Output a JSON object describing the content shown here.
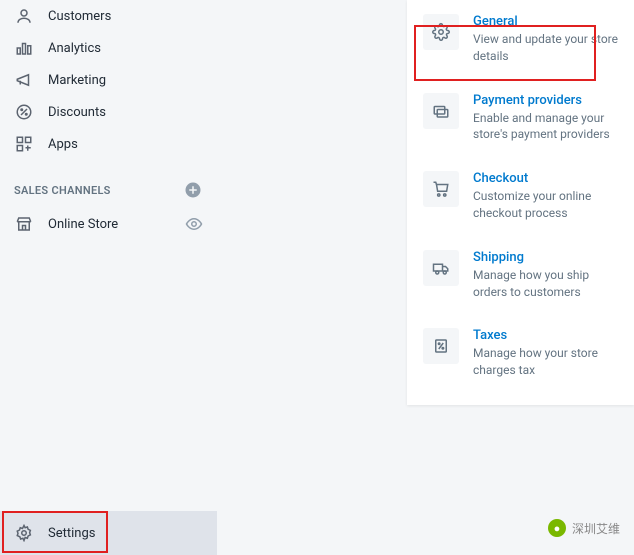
{
  "sidebar": {
    "nav": [
      {
        "label": "Customers",
        "icon": "user"
      },
      {
        "label": "Analytics",
        "icon": "analytics"
      },
      {
        "label": "Marketing",
        "icon": "megaphone"
      },
      {
        "label": "Discounts",
        "icon": "discount"
      },
      {
        "label": "Apps",
        "icon": "apps"
      }
    ],
    "channels_header": "SALES CHANNELS",
    "channels": [
      {
        "label": "Online Store",
        "icon": "store"
      }
    ],
    "settings_label": "Settings"
  },
  "settings_panel": [
    {
      "title": "General",
      "desc": "View and update your store details",
      "icon": "gear"
    },
    {
      "title": "Payment providers",
      "desc": "Enable and manage your store's payment providers",
      "icon": "payment"
    },
    {
      "title": "Checkout",
      "desc": "Customize your online checkout process",
      "icon": "checkout"
    },
    {
      "title": "Shipping",
      "desc": "Manage how you ship orders to customers",
      "icon": "shipping"
    },
    {
      "title": "Taxes",
      "desc": "Manage how your store charges tax",
      "icon": "taxes"
    }
  ],
  "watermark": "深圳艾维"
}
